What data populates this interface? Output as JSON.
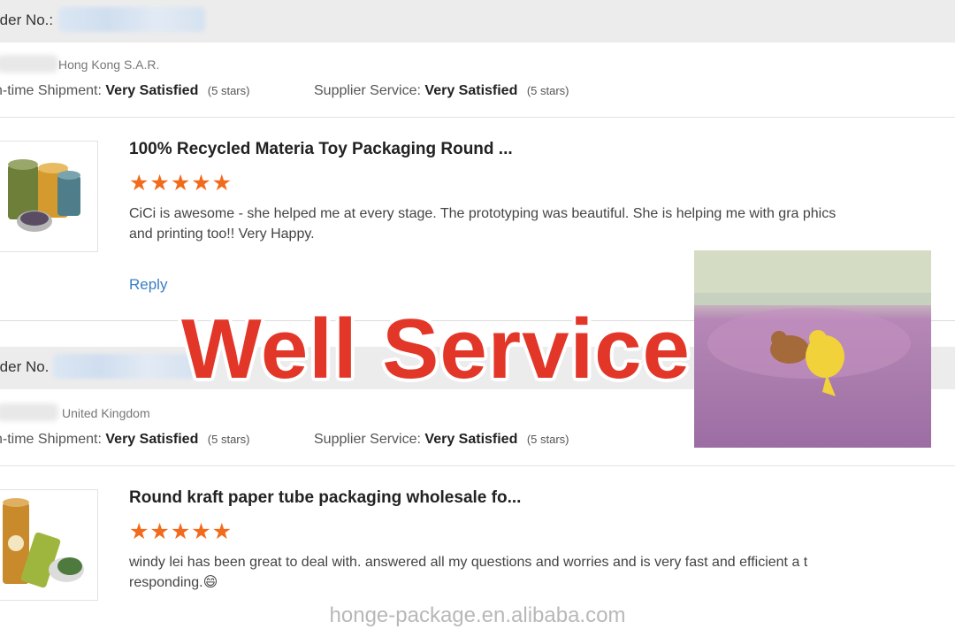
{
  "reviews": [
    {
      "order_label": "rder No.:",
      "country": "Hong Kong S.A.R.",
      "shipment_label": "n-time Shipment:",
      "shipment_value": "Very Satisfied",
      "shipment_stars": "(5 stars)",
      "service_label": "Supplier Service:",
      "service_value": "Very Satisfied",
      "service_stars": "(5 stars)",
      "product_title": "100% Recycled Materia Toy Packaging Round ...",
      "stars": "★★★★★",
      "rating": 5,
      "review_text": "CiCi is awesome - she helped me at every stage. The prototyping was beautiful. She is helping me with gra phics and printing too!! Very Happy.",
      "reply_label": "Reply"
    },
    {
      "order_label": "rder No.",
      "country": "United Kingdom",
      "shipment_label": "n-time Shipment:",
      "shipment_value": "Very Satisfied",
      "shipment_stars": "(5 stars)",
      "service_label": "Supplier Service:",
      "service_value": "Very Satisfied",
      "service_stars": "(5 stars)",
      "product_title": "Round kraft paper tube packaging wholesale fo...",
      "stars": "★★★★★",
      "rating": 5,
      "review_text": "windy lei has been great to deal with. answered all my questions and worries and is very fast and efficient a t responding.😄"
    }
  ],
  "overlay_text": "Well Service!",
  "watermark": "honge-package.en.alibaba.com",
  "colors": {
    "accent": "#e23628",
    "star": "#f26a1b",
    "link": "#3a7fc4"
  }
}
